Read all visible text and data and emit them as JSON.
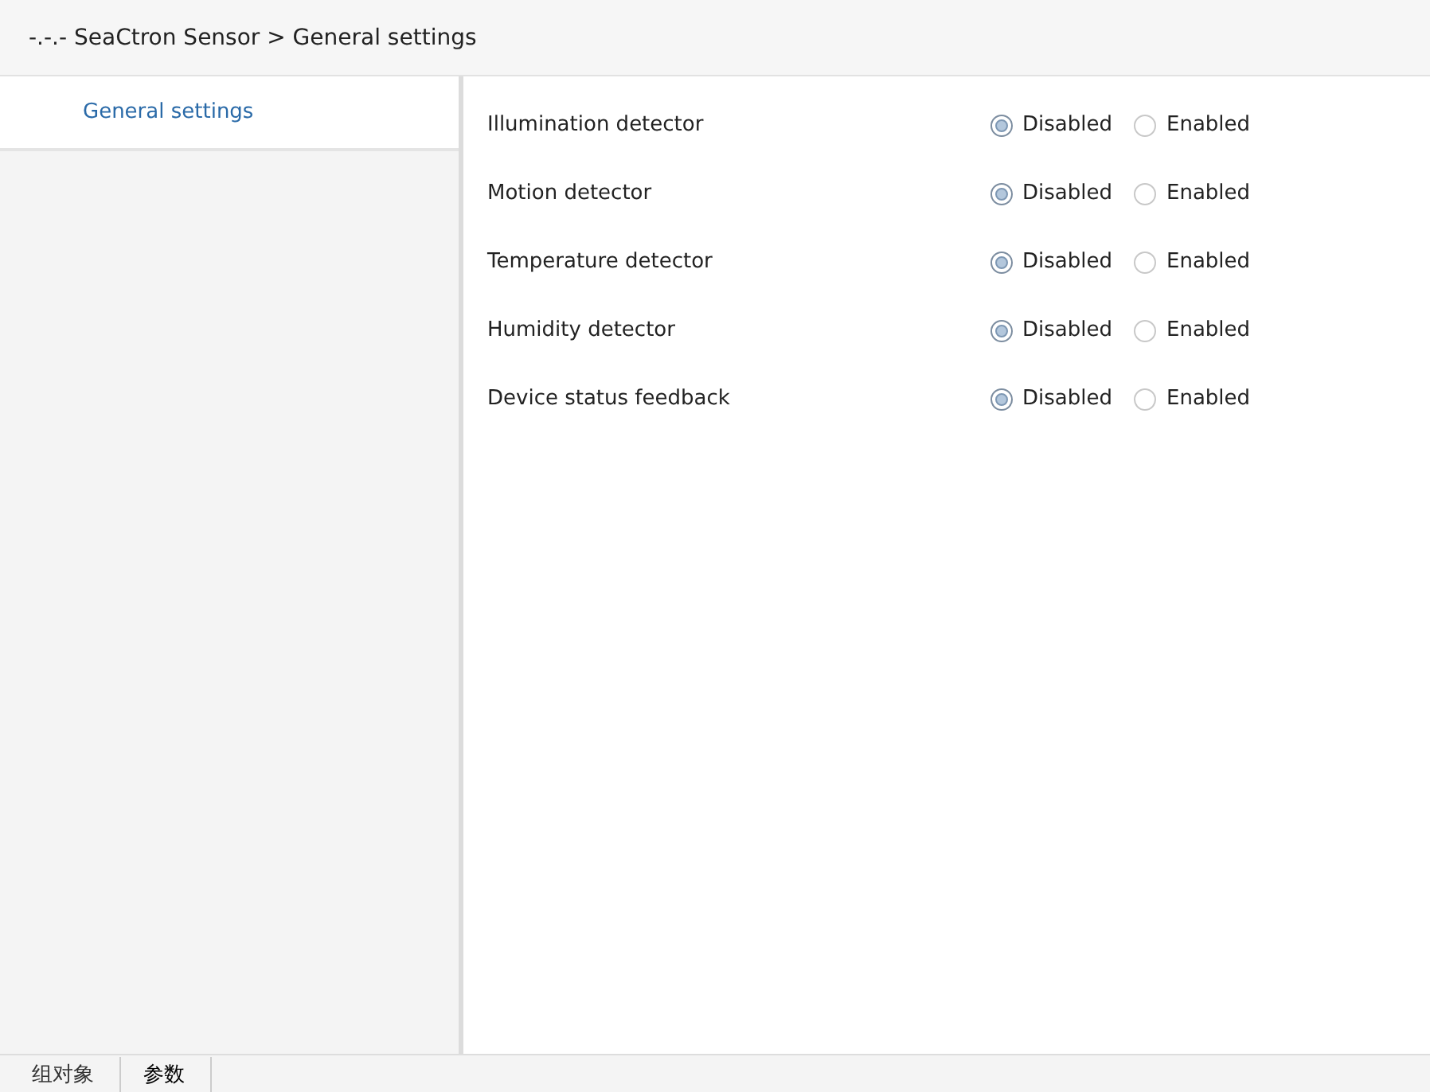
{
  "header": {
    "title": "-.-.- SeaCtron Sensor > General settings"
  },
  "sidebar": {
    "items": [
      {
        "label": "General settings",
        "selected": true
      }
    ]
  },
  "settings": [
    {
      "label": "Illumination detector",
      "options": [
        {
          "label": "Disabled",
          "selected": true
        },
        {
          "label": "Enabled",
          "selected": false
        }
      ]
    },
    {
      "label": "Motion detector",
      "options": [
        {
          "label": "Disabled",
          "selected": true
        },
        {
          "label": "Enabled",
          "selected": false
        }
      ]
    },
    {
      "label": "Temperature detector",
      "options": [
        {
          "label": "Disabled",
          "selected": true
        },
        {
          "label": "Enabled",
          "selected": false
        }
      ]
    },
    {
      "label": "Humidity detector",
      "options": [
        {
          "label": "Disabled",
          "selected": true
        },
        {
          "label": "Enabled",
          "selected": false
        }
      ]
    },
    {
      "label": "Device status feedback",
      "options": [
        {
          "label": "Disabled",
          "selected": true
        },
        {
          "label": "Enabled",
          "selected": false
        }
      ]
    }
  ],
  "bottom_tabs": [
    {
      "label": "组对象",
      "selected": false
    },
    {
      "label": "参数",
      "selected": true
    }
  ]
}
